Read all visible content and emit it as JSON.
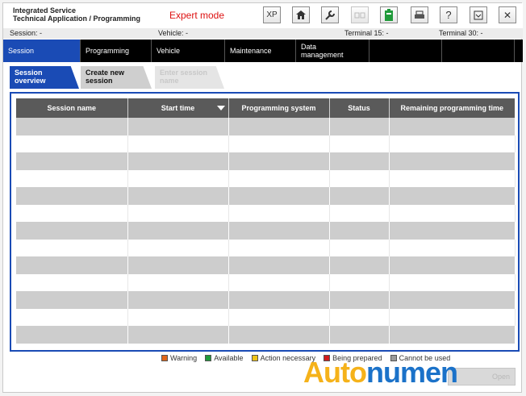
{
  "header": {
    "title_line1": "Integrated Service",
    "title_line2": "Technical Application / Programming",
    "mode": "Expert mode",
    "toolbar": [
      {
        "name": "xp-button",
        "glyph": "XP",
        "enabled": true
      },
      {
        "name": "home-icon",
        "glyph": "⌂",
        "enabled": true
      },
      {
        "name": "wrench-icon",
        "glyph": "🔧",
        "enabled": true
      },
      {
        "name": "display-icon",
        "glyph": "▭▭",
        "enabled": false
      },
      {
        "name": "battery-icon",
        "glyph": "▮",
        "enabled": true
      },
      {
        "name": "print-icon",
        "glyph": "⎙",
        "enabled": true
      },
      {
        "name": "help-icon",
        "glyph": "?",
        "enabled": true
      },
      {
        "name": "minimize-icon",
        "glyph": "⊟",
        "enabled": true
      },
      {
        "name": "close-icon",
        "glyph": "✕",
        "enabled": true
      }
    ]
  },
  "status": {
    "session": "Session:  -",
    "vehicle": "Vehicle:  -",
    "terminal15": "Terminal 15:  -",
    "terminal30": "Terminal 30:  -"
  },
  "nav": {
    "session": "Session",
    "programming": "Programming",
    "vehicle": "Vehicle",
    "maintenance": "Maintenance",
    "data_management": "Data management"
  },
  "subtabs": {
    "overview": "Session overview",
    "create": "Create new session",
    "enter_name": "Enter session name"
  },
  "table": {
    "headers": [
      "Session name",
      "Start time",
      "Programming system",
      "Status",
      "Remaining programming time"
    ],
    "row_count": 13
  },
  "legend": {
    "warning": "Warning",
    "available": "Available",
    "action": "Action necessary",
    "prepared": "Being prepared",
    "unusable": "Cannot be used"
  },
  "colors": {
    "accent": "#1a4bb5",
    "warning": "#e0661a",
    "available": "#1f9a3a",
    "action": "#f0c419",
    "prepared": "#d11c1c",
    "unusable": "#9a9a9a"
  },
  "bottom_button": "Open",
  "watermark": {
    "part1": "Auto",
    "part2": "numen"
  }
}
